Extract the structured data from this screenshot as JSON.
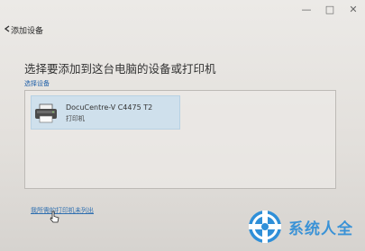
{
  "window": {
    "title": "添加设备",
    "controls": {
      "minimize": "—",
      "maximize": "□",
      "close": "✕"
    }
  },
  "main": {
    "heading": "选择要添加到这台电脑的设备或打印机",
    "subheading": "选择设备"
  },
  "devices": [
    {
      "name": "DocuCentre-V C4475 T2",
      "type": "打印机",
      "icon": "printer-icon"
    }
  ],
  "footer": {
    "link_label": "我所需的打印机未列出"
  },
  "watermark": {
    "text": "系统人全",
    "logo_color": "#2f8fd8"
  },
  "colors": {
    "selection_bg": "#cfe0ec",
    "link": "#2f6fb0",
    "heading": "#333333"
  }
}
